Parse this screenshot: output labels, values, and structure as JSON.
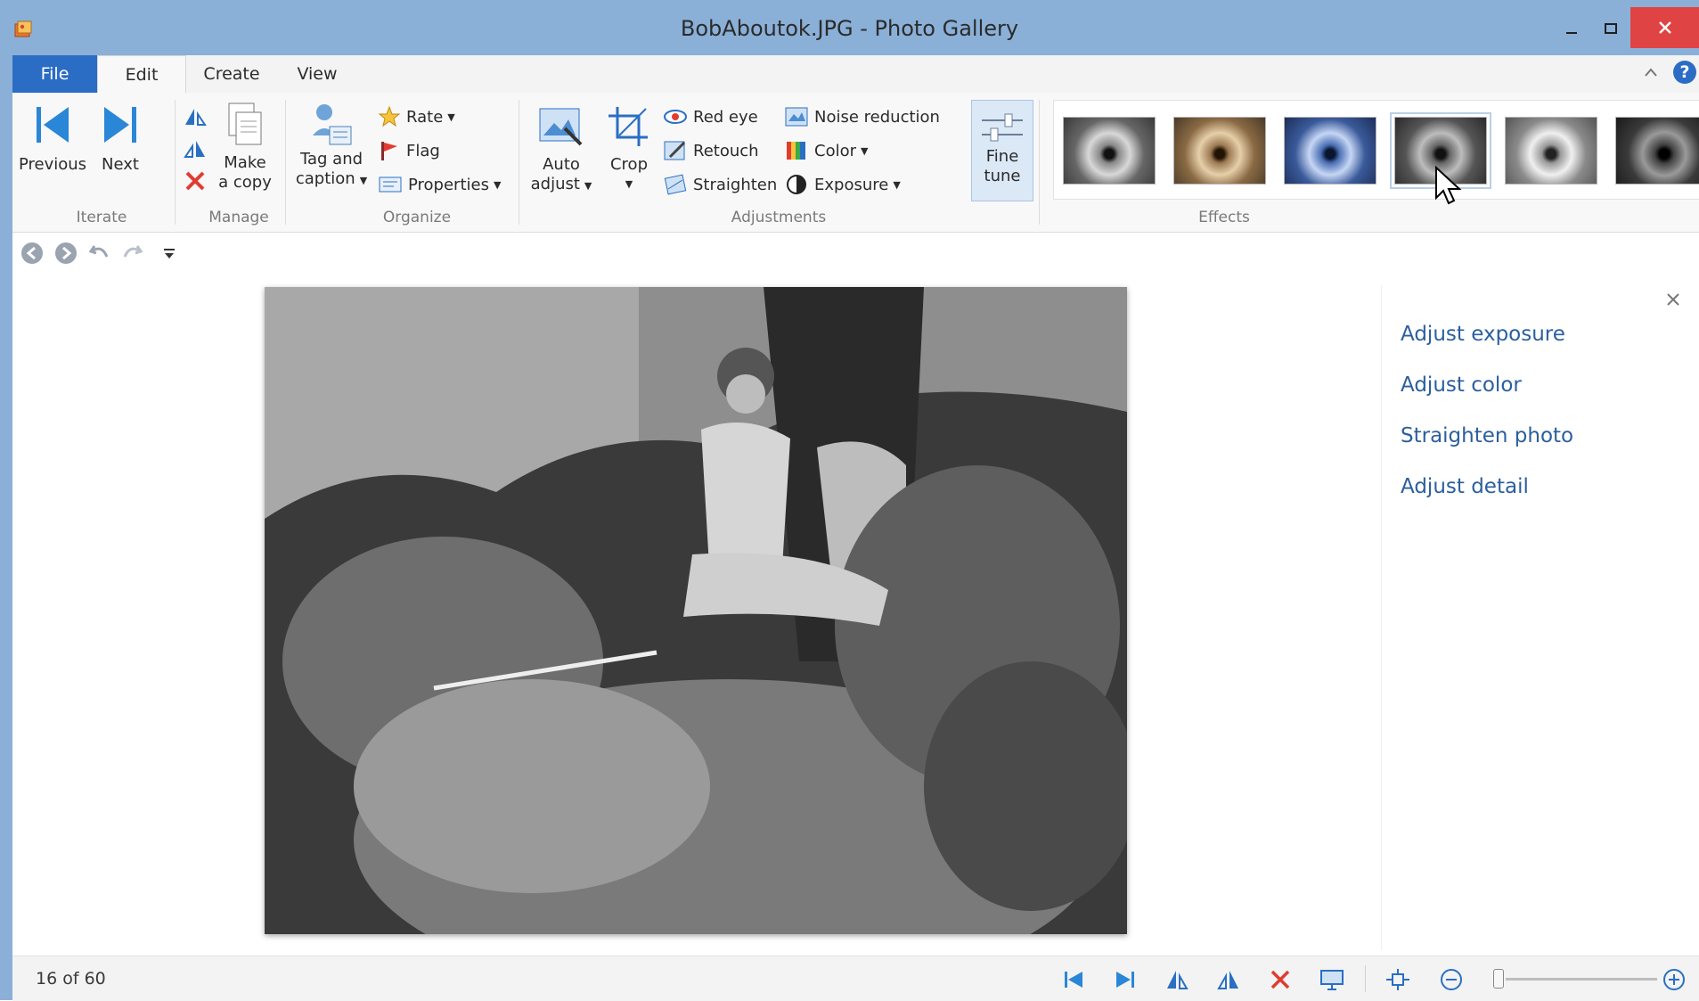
{
  "window": {
    "title": "BobAboutok.JPG - Photo Gallery",
    "minimize": "–",
    "maximize": "☐",
    "close": "✕"
  },
  "tabs": {
    "file": "File",
    "edit": "Edit",
    "create": "Create",
    "view": "View",
    "collapse": "^",
    "help": "?"
  },
  "ribbon": {
    "iterate": {
      "label": "Iterate",
      "previous": "Previous",
      "next": "Next"
    },
    "manage": {
      "label": "Manage",
      "make_copy_1": "Make",
      "make_copy_2": "a copy"
    },
    "organize": {
      "label": "Organize",
      "tag_1": "Tag and",
      "tag_2": "caption",
      "rate": "Rate",
      "flag": "Flag",
      "properties": "Properties"
    },
    "adjustments": {
      "label": "Adjustments",
      "auto_1": "Auto",
      "auto_2": "adjust",
      "crop": "Crop",
      "red_eye": "Red eye",
      "retouch": "Retouch",
      "straighten": "Straighten",
      "noise": "Noise reduction",
      "color": "Color",
      "exposure": "Exposure",
      "fine_1": "Fine",
      "fine_2": "tune"
    },
    "effects": {
      "label": "Effects"
    }
  },
  "side_panel": {
    "items": [
      "Adjust exposure",
      "Adjust color",
      "Straighten photo",
      "Adjust detail"
    ]
  },
  "status": {
    "counter": "16 of 60"
  },
  "colors": {
    "accent": "#2b6cc4",
    "titlebar": "#8ab0d8",
    "close": "#e04343",
    "link": "#2b5f9e"
  }
}
